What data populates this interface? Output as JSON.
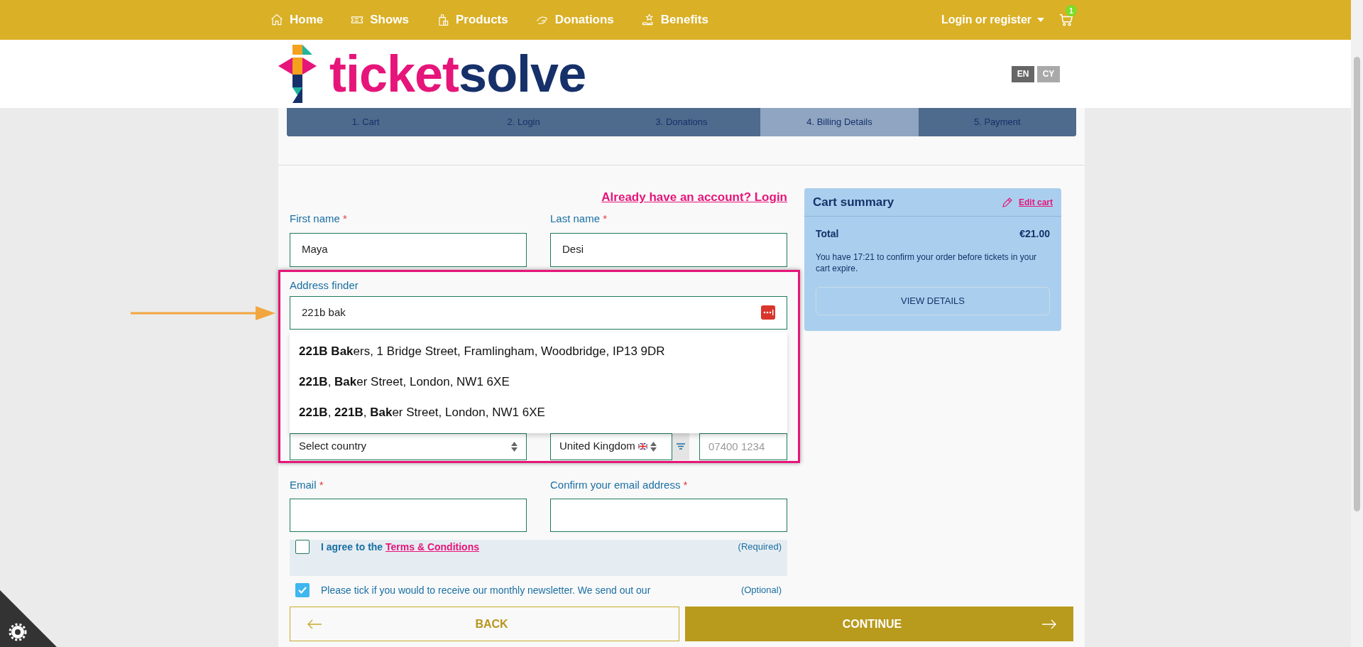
{
  "nav": {
    "items": [
      {
        "label": "Home"
      },
      {
        "label": "Shows"
      },
      {
        "label": "Products"
      },
      {
        "label": "Donations"
      },
      {
        "label": "Benefits"
      }
    ],
    "account": "Login or register",
    "cart_count": "1"
  },
  "logo": {
    "first": "ticket",
    "second": "solve"
  },
  "languages": [
    {
      "label": "EN",
      "selected": true
    },
    {
      "label": "CY",
      "selected": false
    }
  ],
  "steps": [
    {
      "label": "1. Cart",
      "selected": false
    },
    {
      "label": "2. Login",
      "selected": false
    },
    {
      "label": "3. Donations",
      "selected": false
    },
    {
      "label": "4. Billing Details",
      "selected": true
    },
    {
      "label": "5. Payment",
      "selected": false
    }
  ],
  "login_link": "Already have an account? Login",
  "name_fields": [
    {
      "label": "First name",
      "required_mark": "*",
      "value": "Maya"
    },
    {
      "label": "Last name",
      "required_mark": "*",
      "value": "Desi"
    }
  ],
  "address_finder": {
    "label": "Address finder",
    "value": "221b bak",
    "suggestions": [
      "**221B Bak**ers, 1 Bridge Street, Framlingham, Woodbridge, IP13 9DR",
      "**221B**, **Bak**er Street, London, NW1 6XE",
      "**221B**, **221B**, **Bak**er Street, London, NW1 6XE"
    ]
  },
  "country_select": "Select country",
  "phone_country": "United Kingdom",
  "phone_placeholder": "07400 1234",
  "email_fields": [
    {
      "label": "Email",
      "required_mark": "*"
    },
    {
      "label": "Confirm your email address",
      "required_mark": "*"
    }
  ],
  "consents": [
    {
      "text": "I agree to the ",
      "link": "Terms & Conditions",
      "note": "(Required)",
      "checked": false
    },
    {
      "text": "Please tick if you would to receive our monthly newsletter. We send out our",
      "note": "(Optional)",
      "checked": true
    }
  ],
  "cart_summary": {
    "title": "Cart summary",
    "edit": "Edit cart",
    "total_label": "Total",
    "total": "€21.00",
    "message": "You have 17:21 to confirm your order before tickets in your cart expire.",
    "button": "VIEW DETAILS"
  },
  "footer": {
    "back": "BACK",
    "continue": "CONTINUE"
  }
}
